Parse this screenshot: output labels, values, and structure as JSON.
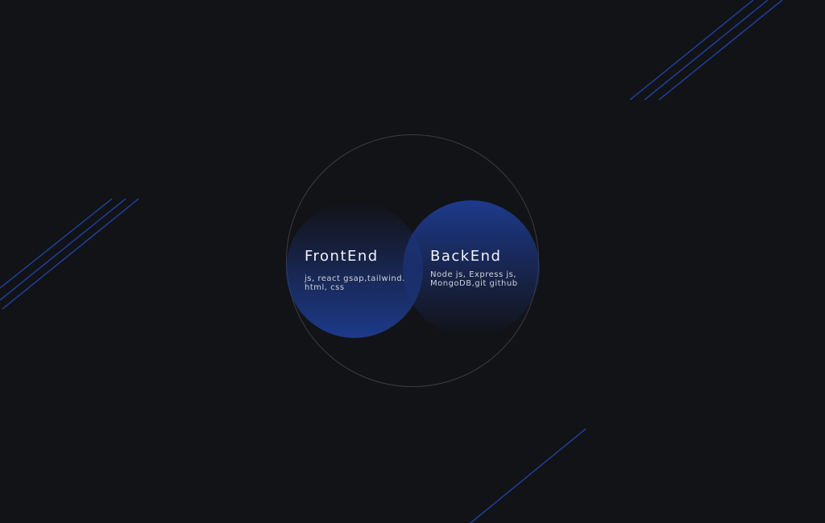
{
  "colors": {
    "background": "#121316",
    "accent_blue": "#1d3a8c",
    "deco_line": "#1f3d94",
    "outer_ring": "#3a3c42"
  },
  "frontend": {
    "title": "FrontEnd",
    "skills": "js, react gsap,tailwind. html, css"
  },
  "backend": {
    "title": "BackEnd",
    "skills": "Node js, Express js, MongoDB,git github"
  }
}
